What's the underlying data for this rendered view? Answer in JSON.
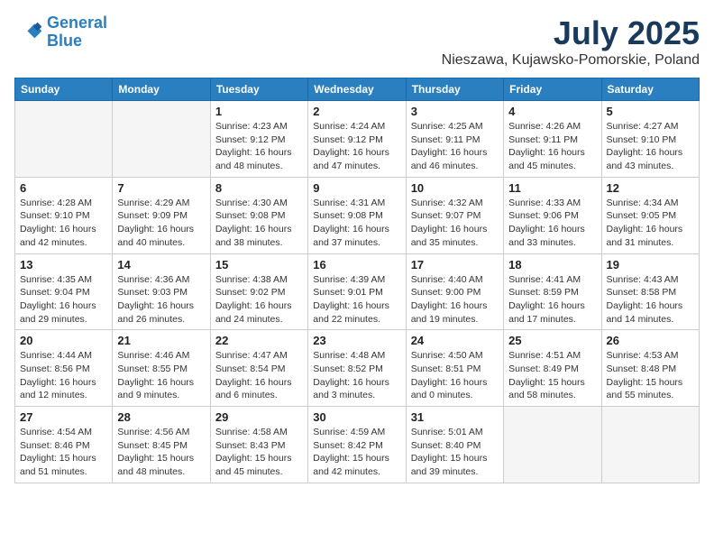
{
  "header": {
    "logo_line1": "General",
    "logo_line2": "Blue",
    "main_title": "July 2025",
    "subtitle": "Nieszawa, Kujawsko-Pomorskie, Poland"
  },
  "columns": [
    "Sunday",
    "Monday",
    "Tuesday",
    "Wednesday",
    "Thursday",
    "Friday",
    "Saturday"
  ],
  "weeks": [
    [
      {
        "day": "",
        "info": ""
      },
      {
        "day": "",
        "info": ""
      },
      {
        "day": "1",
        "info": "Sunrise: 4:23 AM\nSunset: 9:12 PM\nDaylight: 16 hours\nand 48 minutes."
      },
      {
        "day": "2",
        "info": "Sunrise: 4:24 AM\nSunset: 9:12 PM\nDaylight: 16 hours\nand 47 minutes."
      },
      {
        "day": "3",
        "info": "Sunrise: 4:25 AM\nSunset: 9:11 PM\nDaylight: 16 hours\nand 46 minutes."
      },
      {
        "day": "4",
        "info": "Sunrise: 4:26 AM\nSunset: 9:11 PM\nDaylight: 16 hours\nand 45 minutes."
      },
      {
        "day": "5",
        "info": "Sunrise: 4:27 AM\nSunset: 9:10 PM\nDaylight: 16 hours\nand 43 minutes."
      }
    ],
    [
      {
        "day": "6",
        "info": "Sunrise: 4:28 AM\nSunset: 9:10 PM\nDaylight: 16 hours\nand 42 minutes."
      },
      {
        "day": "7",
        "info": "Sunrise: 4:29 AM\nSunset: 9:09 PM\nDaylight: 16 hours\nand 40 minutes."
      },
      {
        "day": "8",
        "info": "Sunrise: 4:30 AM\nSunset: 9:08 PM\nDaylight: 16 hours\nand 38 minutes."
      },
      {
        "day": "9",
        "info": "Sunrise: 4:31 AM\nSunset: 9:08 PM\nDaylight: 16 hours\nand 37 minutes."
      },
      {
        "day": "10",
        "info": "Sunrise: 4:32 AM\nSunset: 9:07 PM\nDaylight: 16 hours\nand 35 minutes."
      },
      {
        "day": "11",
        "info": "Sunrise: 4:33 AM\nSunset: 9:06 PM\nDaylight: 16 hours\nand 33 minutes."
      },
      {
        "day": "12",
        "info": "Sunrise: 4:34 AM\nSunset: 9:05 PM\nDaylight: 16 hours\nand 31 minutes."
      }
    ],
    [
      {
        "day": "13",
        "info": "Sunrise: 4:35 AM\nSunset: 9:04 PM\nDaylight: 16 hours\nand 29 minutes."
      },
      {
        "day": "14",
        "info": "Sunrise: 4:36 AM\nSunset: 9:03 PM\nDaylight: 16 hours\nand 26 minutes."
      },
      {
        "day": "15",
        "info": "Sunrise: 4:38 AM\nSunset: 9:02 PM\nDaylight: 16 hours\nand 24 minutes."
      },
      {
        "day": "16",
        "info": "Sunrise: 4:39 AM\nSunset: 9:01 PM\nDaylight: 16 hours\nand 22 minutes."
      },
      {
        "day": "17",
        "info": "Sunrise: 4:40 AM\nSunset: 9:00 PM\nDaylight: 16 hours\nand 19 minutes."
      },
      {
        "day": "18",
        "info": "Sunrise: 4:41 AM\nSunset: 8:59 PM\nDaylight: 16 hours\nand 17 minutes."
      },
      {
        "day": "19",
        "info": "Sunrise: 4:43 AM\nSunset: 8:58 PM\nDaylight: 16 hours\nand 14 minutes."
      }
    ],
    [
      {
        "day": "20",
        "info": "Sunrise: 4:44 AM\nSunset: 8:56 PM\nDaylight: 16 hours\nand 12 minutes."
      },
      {
        "day": "21",
        "info": "Sunrise: 4:46 AM\nSunset: 8:55 PM\nDaylight: 16 hours\nand 9 minutes."
      },
      {
        "day": "22",
        "info": "Sunrise: 4:47 AM\nSunset: 8:54 PM\nDaylight: 16 hours\nand 6 minutes."
      },
      {
        "day": "23",
        "info": "Sunrise: 4:48 AM\nSunset: 8:52 PM\nDaylight: 16 hours\nand 3 minutes."
      },
      {
        "day": "24",
        "info": "Sunrise: 4:50 AM\nSunset: 8:51 PM\nDaylight: 16 hours\nand 0 minutes."
      },
      {
        "day": "25",
        "info": "Sunrise: 4:51 AM\nSunset: 8:49 PM\nDaylight: 15 hours\nand 58 minutes."
      },
      {
        "day": "26",
        "info": "Sunrise: 4:53 AM\nSunset: 8:48 PM\nDaylight: 15 hours\nand 55 minutes."
      }
    ],
    [
      {
        "day": "27",
        "info": "Sunrise: 4:54 AM\nSunset: 8:46 PM\nDaylight: 15 hours\nand 51 minutes."
      },
      {
        "day": "28",
        "info": "Sunrise: 4:56 AM\nSunset: 8:45 PM\nDaylight: 15 hours\nand 48 minutes."
      },
      {
        "day": "29",
        "info": "Sunrise: 4:58 AM\nSunset: 8:43 PM\nDaylight: 15 hours\nand 45 minutes."
      },
      {
        "day": "30",
        "info": "Sunrise: 4:59 AM\nSunset: 8:42 PM\nDaylight: 15 hours\nand 42 minutes."
      },
      {
        "day": "31",
        "info": "Sunrise: 5:01 AM\nSunset: 8:40 PM\nDaylight: 15 hours\nand 39 minutes."
      },
      {
        "day": "",
        "info": ""
      },
      {
        "day": "",
        "info": ""
      }
    ]
  ]
}
